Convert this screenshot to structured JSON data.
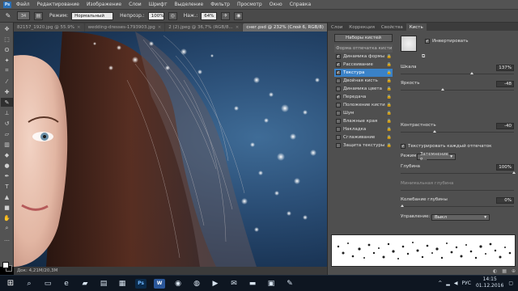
{
  "menubar": {
    "logo": "Ps",
    "items": [
      "Файл",
      "Редактирование",
      "Изображение",
      "Слои",
      "Шрифт",
      "Выделение",
      "Фильтр",
      "Просмотр",
      "Окно",
      "Справка"
    ]
  },
  "options": {
    "size_value": "34",
    "mode_label": "Режим:",
    "mode_value": "Нормальный",
    "opacity_label": "Непрозр.:",
    "opacity_value": "100%",
    "flow_label": "Наж.:",
    "flow_value": "64%"
  },
  "doc_tabs": [
    {
      "label": "82157_1920.jpg @ 55.9%",
      "active": false
    },
    {
      "label": "wedding-dresses-1793903.jpg",
      "active": false
    },
    {
      "label": "2 (2).jpeg @ 36,7% (RGB/8...",
      "active": false
    },
    {
      "label": "снег.psd @ 232% (Слой 6, RGB/8)",
      "active": true
    }
  ],
  "status": {
    "doc_size": "Док: 4,21M/20,3M"
  },
  "panel": {
    "tabs": [
      "Слои",
      "Коррекция",
      "Свойства",
      "Кисть"
    ],
    "active_tab": "Кисть",
    "presets_button": "Наборы кистей",
    "brush_list": [
      {
        "label": "Форма отпечатка кисти",
        "checked": null,
        "header": true,
        "selected": false
      },
      {
        "label": "Динамика формы",
        "checked": true,
        "header": false,
        "selected": false
      },
      {
        "label": "Рассеивание",
        "checked": true,
        "header": false,
        "selected": false
      },
      {
        "label": "Текстура",
        "checked": true,
        "header": false,
        "selected": true
      },
      {
        "label": "Двойная кисть",
        "checked": false,
        "header": false,
        "selected": false
      },
      {
        "label": "Динамика цвета",
        "checked": false,
        "header": false,
        "selected": false
      },
      {
        "label": "Передача",
        "checked": true,
        "header": false,
        "selected": false
      },
      {
        "label": "Положение кисти",
        "checked": false,
        "header": false,
        "selected": false
      },
      {
        "label": "Шум",
        "checked": false,
        "header": false,
        "selected": false
      },
      {
        "label": "Влажные края",
        "checked": false,
        "header": false,
        "selected": false
      },
      {
        "label": "Накладка",
        "checked": false,
        "header": false,
        "selected": false
      },
      {
        "label": "Сглаживание",
        "checked": false,
        "header": false,
        "selected": false
      },
      {
        "label": "Защита текстуры",
        "checked": false,
        "header": false,
        "selected": false
      }
    ],
    "texture": {
      "invert_label": "Инвертировать",
      "scale_label": "Шкала",
      "scale_value": "137%",
      "brightness_label": "Яркость",
      "brightness_value": "-48",
      "contrast_label": "Контрастность",
      "contrast_value": "-40",
      "texture_each_tip_label": "Текстурировать каждый отпечаток",
      "mode_label": "Режим:",
      "mode_value": "Затемнение о...",
      "depth_label": "Глубина",
      "depth_value": "100%",
      "min_depth_label": "Минимальная глубина",
      "depth_jitter_label": "Колебание глубины",
      "depth_jitter_value": "0%",
      "control_label": "Управление:",
      "control_value": "Выкл"
    }
  },
  "taskbar": {
    "lang": "РУС",
    "time": "14:15",
    "date": "01.12.2016"
  },
  "colors": {
    "menubar": "#535353",
    "panel": "#4f4f4f",
    "selected": "#3a82c8",
    "taskbar": "#0e1621"
  }
}
